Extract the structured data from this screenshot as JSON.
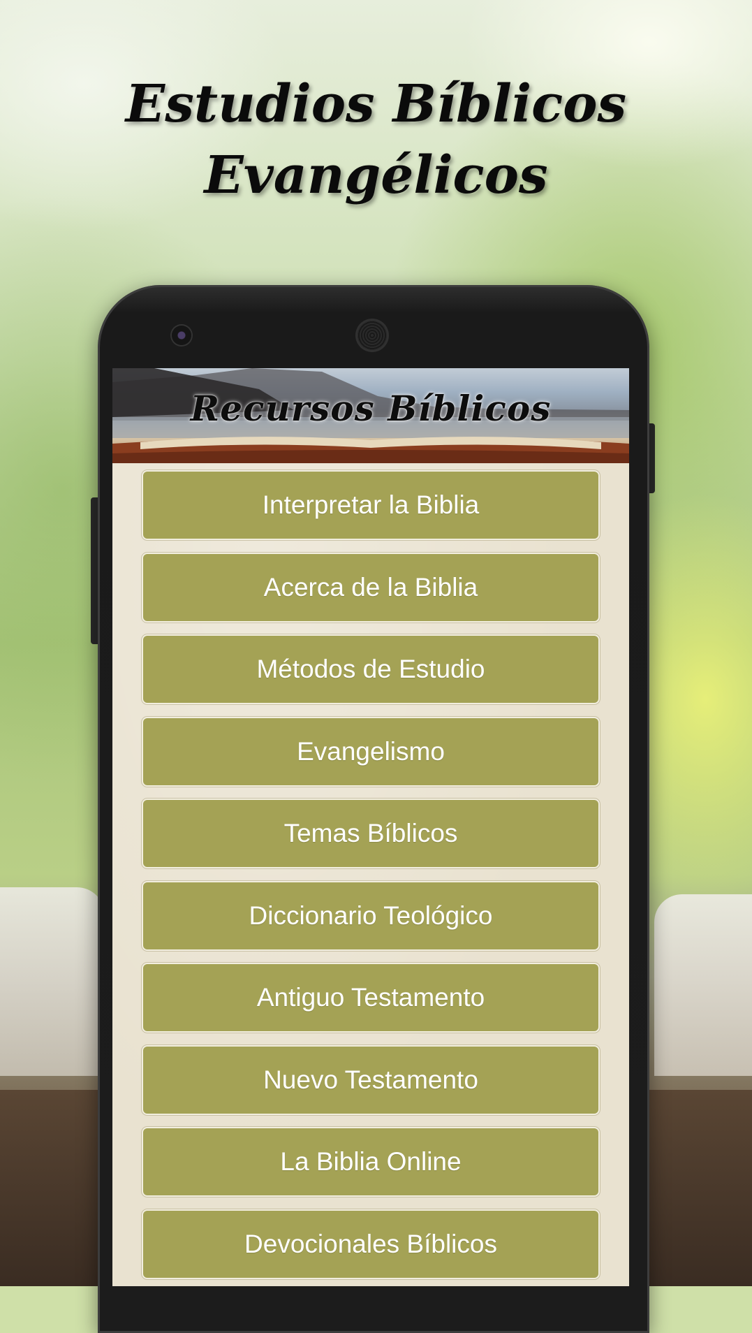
{
  "headline": {
    "line1": "Estudios Bíblicos",
    "line2": "Evangélicos"
  },
  "app": {
    "banner_title": "Recursos Bíblicos",
    "menu": [
      {
        "label": "Interpretar la Biblia"
      },
      {
        "label": "Acerca de la Biblia"
      },
      {
        "label": "Métodos de Estudio"
      },
      {
        "label": "Evangelismo"
      },
      {
        "label": "Temas Bíblicos"
      },
      {
        "label": "Diccionario Teológico"
      },
      {
        "label": "Antiguo Testamento"
      },
      {
        "label": "Nuevo Testamento"
      },
      {
        "label": "La Biblia Online"
      },
      {
        "label": "Devocionales Bíblicos"
      }
    ]
  },
  "colors": {
    "button_fill": "#a4a255",
    "button_text": "#ffffff",
    "screen_bg": "#e9e2d0",
    "phone_body": "#1c1c1c"
  }
}
